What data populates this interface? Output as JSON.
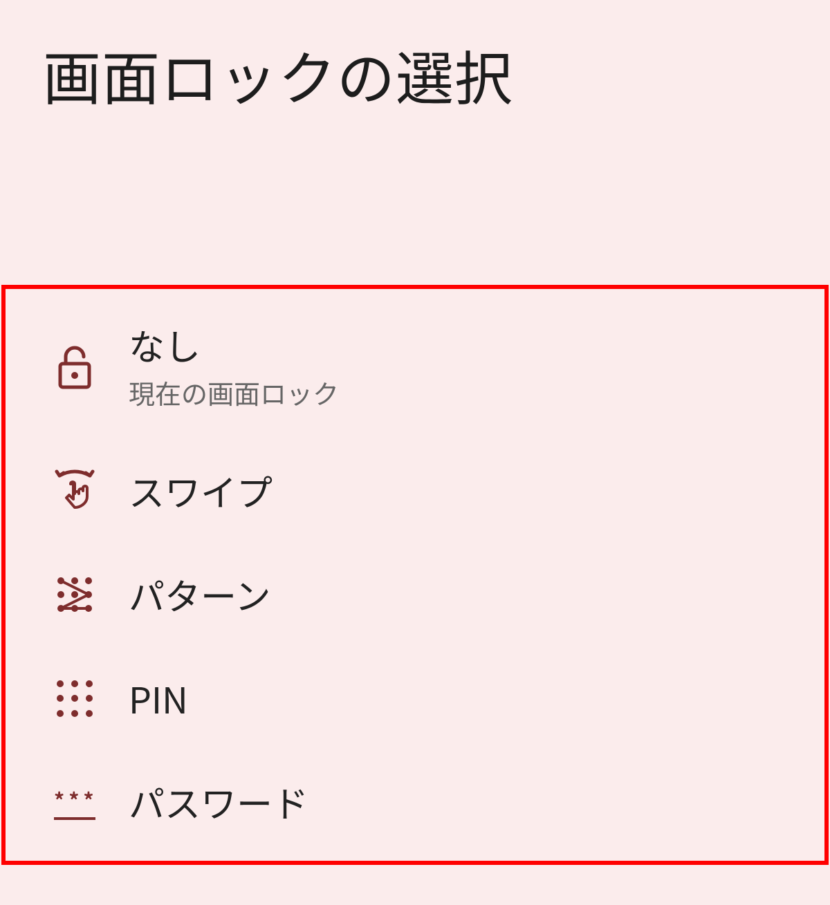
{
  "header": {
    "title": "画面ロックの選択"
  },
  "options": {
    "none": {
      "label": "なし",
      "subtext": "現在の画面ロック"
    },
    "swipe": {
      "label": "スワイプ"
    },
    "pattern": {
      "label": "パターン"
    },
    "pin": {
      "label": "PIN"
    },
    "password": {
      "label": "パスワード"
    }
  },
  "colors": {
    "icon": "#7e2d2d",
    "highlight_border": "#ff0000",
    "background": "#fbecec"
  }
}
